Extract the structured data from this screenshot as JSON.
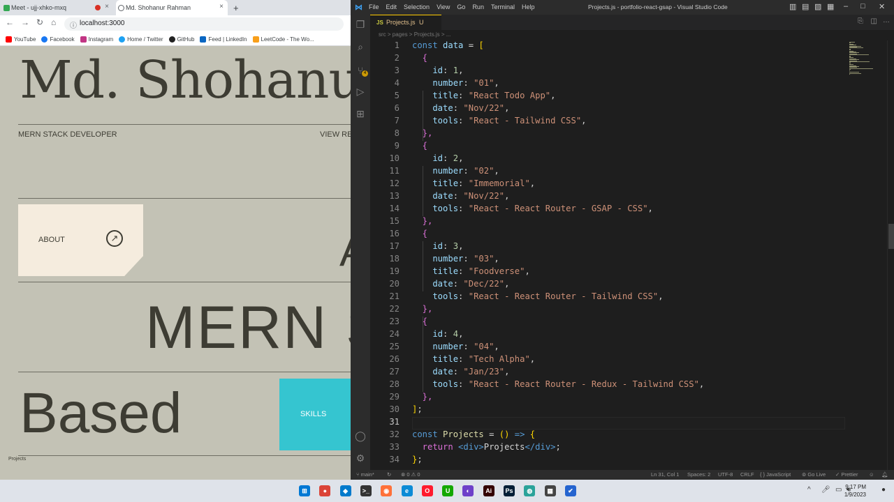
{
  "browser": {
    "tabs": [
      {
        "label": "Meet - ujj-xhko-mxq",
        "icon": "google-meet-icon",
        "close": "×"
      },
      {
        "label": "Md. Shohanur Rahman",
        "icon": "globe-icon",
        "close": "×"
      }
    ],
    "new_tab": "+",
    "url": "localhost:3000",
    "bookmarks": [
      {
        "label": "YouTube",
        "color": "#ff0000"
      },
      {
        "label": "Facebook",
        "color": "#1877f2"
      },
      {
        "label": "Instagram",
        "color": "#c13584"
      },
      {
        "label": "Home / Twitter",
        "color": "#1da1f2"
      },
      {
        "label": "GitHub",
        "color": "#222222"
      },
      {
        "label": "Feed | LinkedIn",
        "color": "#0a66c2"
      },
      {
        "label": "LeetCode - The Wo...",
        "color": "#f89f1b"
      }
    ]
  },
  "site": {
    "name": "Md. Shohanu",
    "role": "MERN STACK DEVELOPER",
    "view_link": "VIEW RE",
    "about_label": "ABOUT",
    "about_arrow": "↗",
    "mern_text": "MERN S",
    "partial_letter": "A",
    "based_text": "Based",
    "skills_label": "SKILLS",
    "status_url": "Projects",
    "bg_color": "#c3c2b5",
    "accent_cyan": "#35c5d0",
    "card_color": "#f5ecde"
  },
  "vscode": {
    "menu": [
      "File",
      "Edit",
      "Selection",
      "View",
      "Go",
      "Run",
      "Terminal",
      "Help"
    ],
    "window_title": "Projects.js - portfolio-react-gsap - Visual Studio Code",
    "tab_label": "Projects.js",
    "tab_status": "U",
    "breadcrumb": "src > pages > Projects.js > ...",
    "scm_badge": "4",
    "current_line": 31,
    "status": {
      "branch": "main*",
      "errors": "⊗ 0 ⚠ 0",
      "position": "Ln 31, Col 1",
      "spaces": "Spaces: 2",
      "encoding": "UTF-8",
      "eol": "CRLF",
      "language": "{ } JavaScript",
      "golive": "Go Live",
      "prettier": "✓ Prettier"
    },
    "lines": [
      [
        [
          "k",
          "const "
        ],
        [
          "v",
          "data"
        ],
        [
          "tx",
          " = "
        ],
        [
          "y",
          "["
        ]
      ],
      [
        [
          "p",
          "  {"
        ]
      ],
      [
        [
          "v",
          "    id"
        ],
        [
          "tx",
          ": "
        ],
        [
          "n",
          "1"
        ],
        [
          "tx",
          ","
        ]
      ],
      [
        [
          "v",
          "    number"
        ],
        [
          "tx",
          ": "
        ],
        [
          "s",
          "\"01\""
        ],
        [
          "tx",
          ","
        ]
      ],
      [
        [
          "v",
          "    title"
        ],
        [
          "tx",
          ": "
        ],
        [
          "s",
          "\"React Todo App\""
        ],
        [
          "tx",
          ","
        ]
      ],
      [
        [
          "v",
          "    date"
        ],
        [
          "tx",
          ": "
        ],
        [
          "s",
          "\"Nov/22\""
        ],
        [
          "tx",
          ","
        ]
      ],
      [
        [
          "v",
          "    tools"
        ],
        [
          "tx",
          ": "
        ],
        [
          "s",
          "\"React - Tailwind CSS\""
        ],
        [
          "tx",
          ","
        ]
      ],
      [
        [
          "p",
          "  },"
        ]
      ],
      [
        [
          "p",
          "  {"
        ]
      ],
      [
        [
          "v",
          "    id"
        ],
        [
          "tx",
          ": "
        ],
        [
          "n",
          "2"
        ],
        [
          "tx",
          ","
        ]
      ],
      [
        [
          "v",
          "    number"
        ],
        [
          "tx",
          ": "
        ],
        [
          "s",
          "\"02\""
        ],
        [
          "tx",
          ","
        ]
      ],
      [
        [
          "v",
          "    title"
        ],
        [
          "tx",
          ": "
        ],
        [
          "s",
          "\"Immemorial\""
        ],
        [
          "tx",
          ","
        ]
      ],
      [
        [
          "v",
          "    date"
        ],
        [
          "tx",
          ": "
        ],
        [
          "s",
          "\"Nov/22\""
        ],
        [
          "tx",
          ","
        ]
      ],
      [
        [
          "v",
          "    tools"
        ],
        [
          "tx",
          ": "
        ],
        [
          "s",
          "\"React - React Router - GSAP - CSS\""
        ],
        [
          "tx",
          ","
        ]
      ],
      [
        [
          "p",
          "  },"
        ]
      ],
      [
        [
          "p",
          "  {"
        ]
      ],
      [
        [
          "v",
          "    id"
        ],
        [
          "tx",
          ": "
        ],
        [
          "n",
          "3"
        ],
        [
          "tx",
          ","
        ]
      ],
      [
        [
          "v",
          "    number"
        ],
        [
          "tx",
          ": "
        ],
        [
          "s",
          "\"03\""
        ],
        [
          "tx",
          ","
        ]
      ],
      [
        [
          "v",
          "    title"
        ],
        [
          "tx",
          ": "
        ],
        [
          "s",
          "\"Foodverse\""
        ],
        [
          "tx",
          ","
        ]
      ],
      [
        [
          "v",
          "    date"
        ],
        [
          "tx",
          ": "
        ],
        [
          "s",
          "\"Dec/22\""
        ],
        [
          "tx",
          ","
        ]
      ],
      [
        [
          "v",
          "    tools"
        ],
        [
          "tx",
          ": "
        ],
        [
          "s",
          "\"React - React Router - Tailwind CSS\""
        ],
        [
          "tx",
          ","
        ]
      ],
      [
        [
          "p",
          "  },"
        ]
      ],
      [
        [
          "p",
          "  {"
        ]
      ],
      [
        [
          "v",
          "    id"
        ],
        [
          "tx",
          ": "
        ],
        [
          "n",
          "4"
        ],
        [
          "tx",
          ","
        ]
      ],
      [
        [
          "v",
          "    number"
        ],
        [
          "tx",
          ": "
        ],
        [
          "s",
          "\"04\""
        ],
        [
          "tx",
          ","
        ]
      ],
      [
        [
          "v",
          "    title"
        ],
        [
          "tx",
          ": "
        ],
        [
          "s",
          "\"Tech Alpha\""
        ],
        [
          "tx",
          ","
        ]
      ],
      [
        [
          "v",
          "    date"
        ],
        [
          "tx",
          ": "
        ],
        [
          "s",
          "\"Jan/23\""
        ],
        [
          "tx",
          ","
        ]
      ],
      [
        [
          "v",
          "    tools"
        ],
        [
          "tx",
          ": "
        ],
        [
          "s",
          "\"React - React Router - Redux - Tailwind CSS\""
        ],
        [
          "tx",
          ","
        ]
      ],
      [
        [
          "p",
          "  },"
        ]
      ],
      [
        [
          "y",
          "]"
        ],
        [
          "tx",
          ";"
        ]
      ],
      [
        [
          "tx",
          ""
        ]
      ],
      [
        [
          "k",
          "const "
        ],
        [
          "f",
          "Projects"
        ],
        [
          "tx",
          " = "
        ],
        [
          "y",
          "()"
        ],
        [
          "k",
          " => "
        ],
        [
          "y",
          "{"
        ]
      ],
      [
        [
          "p",
          "  return "
        ],
        [
          "t",
          "<"
        ],
        [
          "k",
          "div"
        ],
        [
          "t",
          ">"
        ],
        [
          "tx",
          "Projects"
        ],
        [
          "t",
          "</"
        ],
        [
          "k",
          "div"
        ],
        [
          "t",
          ">"
        ],
        [
          "tx",
          ";"
        ]
      ],
      [
        [
          "y",
          "}"
        ],
        [
          "tx",
          ";"
        ]
      ]
    ]
  },
  "taskbar": {
    "time": "9:17 PM",
    "date": "1/9/2023",
    "apps": [
      {
        "name": "windows-start-icon",
        "color": "#0078d4",
        "glyph": "⊞"
      },
      {
        "name": "chrome-icon",
        "color": "#db4437",
        "glyph": "●"
      },
      {
        "name": "vscode-icon",
        "color": "#007acc",
        "glyph": "◆"
      },
      {
        "name": "terminal-icon",
        "color": "#333333",
        "glyph": ">_"
      },
      {
        "name": "firefox-icon",
        "color": "#ff7139",
        "glyph": "◉"
      },
      {
        "name": "edge-icon",
        "color": "#0c8bd6",
        "glyph": "e"
      },
      {
        "name": "opera-icon",
        "color": "#ff1b2d",
        "glyph": "O"
      },
      {
        "name": "upwork-icon",
        "color": "#14a800",
        "glyph": "U"
      },
      {
        "name": "github-desktop-icon",
        "color": "#6e40c9",
        "glyph": "◐"
      },
      {
        "name": "illustrator-icon",
        "color": "#330000",
        "glyph": "Ai"
      },
      {
        "name": "photoshop-icon",
        "color": "#001e36",
        "glyph": "Ps"
      },
      {
        "name": "globe-app-icon",
        "color": "#2aa39a",
        "glyph": "◍"
      },
      {
        "name": "calculator-icon",
        "color": "#444444",
        "glyph": "▦"
      },
      {
        "name": "todo-icon",
        "color": "#2564cf",
        "glyph": "✔"
      }
    ]
  }
}
